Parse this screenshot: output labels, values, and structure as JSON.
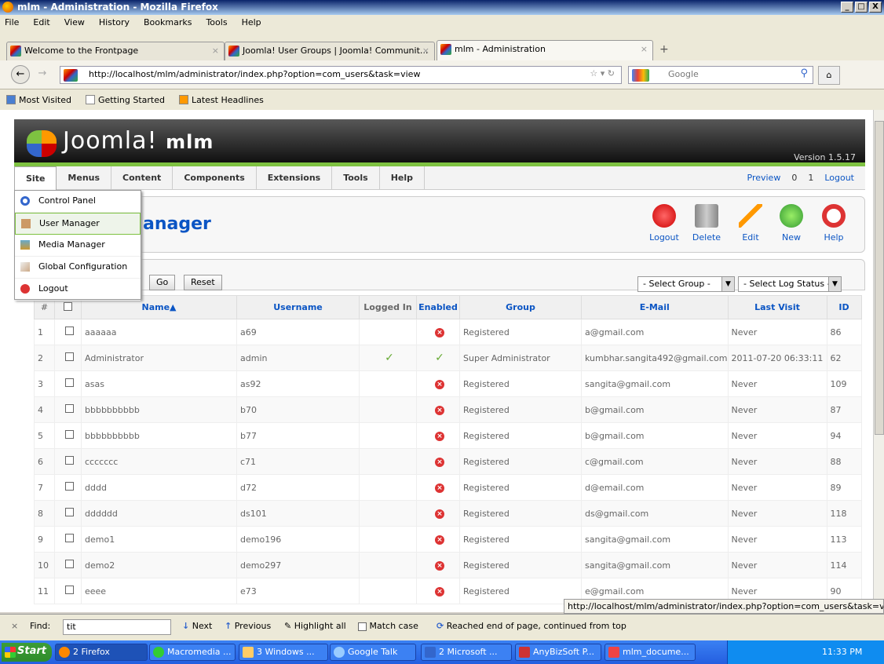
{
  "window": {
    "title": "mlm - Administration - Mozilla Firefox",
    "min": "_",
    "max": "□",
    "close": "X"
  },
  "menubar": [
    "File",
    "Edit",
    "View",
    "History",
    "Bookmarks",
    "Tools",
    "Help"
  ],
  "tabs": [
    {
      "label": "Welcome to the Frontpage",
      "close": "×"
    },
    {
      "label": "Joomla! User Groups | Joomla! Communit...",
      "close": "×"
    },
    {
      "label": "mlm - Administration",
      "close": "×"
    }
  ],
  "newtab": "+",
  "nav": {
    "url": "http://localhost/mlm/administrator/index.php?option=com_users&task=view",
    "search_placeholder": "Google"
  },
  "bookmarks": [
    "Most Visited",
    "Getting Started",
    "Latest Headlines"
  ],
  "joomla": {
    "brand": "Joomla!",
    "site": "mlm",
    "version": "Version 1.5.17"
  },
  "jmenu": [
    "Site",
    "Menus",
    "Content",
    "Components",
    "Extensions",
    "Tools",
    "Help"
  ],
  "jright": {
    "preview": "Preview",
    "messages": "0",
    "users": "1",
    "logout": "Logout"
  },
  "dropdown": [
    "Control Panel",
    "User Manager",
    "Media Manager",
    "Global Configuration",
    "Logout"
  ],
  "page_title": "anager",
  "toolbar": [
    "Logout",
    "Delete",
    "Edit",
    "New",
    "Help"
  ],
  "filter": {
    "go": "Go",
    "reset": "Reset",
    "group": "- Select Group -",
    "log": "- Select Log Status -"
  },
  "columns": [
    "#",
    "Name▲",
    "Username",
    "Logged In",
    "Enabled",
    "Group",
    "E-Mail",
    "Last Visit",
    "ID"
  ],
  "rows": [
    {
      "n": "1",
      "name": "aaaaaa",
      "user": "a69",
      "logged": "",
      "enabled": false,
      "group": "Registered",
      "email": "a@gmail.com",
      "visit": "Never",
      "id": "86"
    },
    {
      "n": "2",
      "name": "Administrator",
      "user": "admin",
      "logged": "yes",
      "enabled": true,
      "group": "Super Administrator",
      "email": "kumbhar.sangita492@gmail.com",
      "visit": "2011-07-20 06:33:11",
      "id": "62"
    },
    {
      "n": "3",
      "name": "asas",
      "user": "as92",
      "logged": "",
      "enabled": false,
      "group": "Registered",
      "email": "sangita@gmail.com",
      "visit": "Never",
      "id": "109"
    },
    {
      "n": "4",
      "name": "bbbbbbbbbb",
      "user": "b70",
      "logged": "",
      "enabled": false,
      "group": "Registered",
      "email": "b@gmail.com",
      "visit": "Never",
      "id": "87"
    },
    {
      "n": "5",
      "name": "bbbbbbbbbb",
      "user": "b77",
      "logged": "",
      "enabled": false,
      "group": "Registered",
      "email": "b@gmail.com",
      "visit": "Never",
      "id": "94"
    },
    {
      "n": "6",
      "name": "ccccccc",
      "user": "c71",
      "logged": "",
      "enabled": false,
      "group": "Registered",
      "email": "c@gmail.com",
      "visit": "Never",
      "id": "88"
    },
    {
      "n": "7",
      "name": "dddd",
      "user": "d72",
      "logged": "",
      "enabled": false,
      "group": "Registered",
      "email": "d@email.com",
      "visit": "Never",
      "id": "89"
    },
    {
      "n": "8",
      "name": "dddddd",
      "user": "ds101",
      "logged": "",
      "enabled": false,
      "group": "Registered",
      "email": "ds@gmail.com",
      "visit": "Never",
      "id": "118"
    },
    {
      "n": "9",
      "name": "demo1",
      "user": "demo196",
      "logged": "",
      "enabled": false,
      "group": "Registered",
      "email": "sangita@gmail.com",
      "visit": "Never",
      "id": "113"
    },
    {
      "n": "10",
      "name": "demo2",
      "user": "demo297",
      "logged": "",
      "enabled": false,
      "group": "Registered",
      "email": "sangita@gmail.com",
      "visit": "Never",
      "id": "114"
    },
    {
      "n": "11",
      "name": "eeee",
      "user": "e73",
      "logged": "",
      "enabled": false,
      "group": "Registered",
      "email": "e@gmail.com",
      "visit": "Never",
      "id": "90"
    }
  ],
  "status_url": "http://localhost/mlm/administrator/index.php?option=com_users&task=view",
  "findbar": {
    "close": "×",
    "label": "Find:",
    "value": "tit",
    "next": "Next",
    "previous": "Previous",
    "highlight": "Highlight all",
    "match": "Match case",
    "message": "Reached end of page, continued from top"
  },
  "taskbar": {
    "start": "Start",
    "items": [
      "2 Firefox",
      "Macromedia ...",
      "3 Windows ...",
      "Google Talk",
      "2 Microsoft ...",
      "AnyBizSoft P...",
      "mlm_docume..."
    ],
    "clock": "11:33 PM"
  }
}
